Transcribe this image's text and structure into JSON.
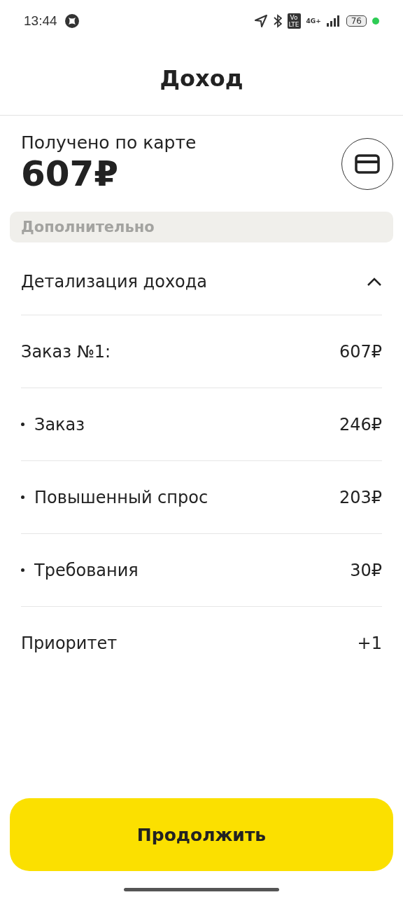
{
  "status_bar": {
    "time": "13:44",
    "volte": [
      "Vo",
      "LTE"
    ],
    "network": "4G+",
    "battery": "76"
  },
  "header": {
    "title": "Доход"
  },
  "received": {
    "label": "Получено по карте",
    "amount": "607₽"
  },
  "section": {
    "title": "Дополнительно"
  },
  "details": {
    "title": "Детализация дохода",
    "expanded": true,
    "rows": [
      {
        "kind": "plain",
        "label": "Заказ №1:",
        "value": "607₽"
      },
      {
        "kind": "item",
        "label": "Заказ",
        "value": "246₽"
      },
      {
        "kind": "item",
        "label": "Повышенный спрос",
        "value": "203₽"
      },
      {
        "kind": "item",
        "label": "Требования",
        "value": "30₽"
      },
      {
        "kind": "plain",
        "label": "Приоритет",
        "value": "+1"
      }
    ]
  },
  "button": {
    "label": "Продолжить"
  }
}
